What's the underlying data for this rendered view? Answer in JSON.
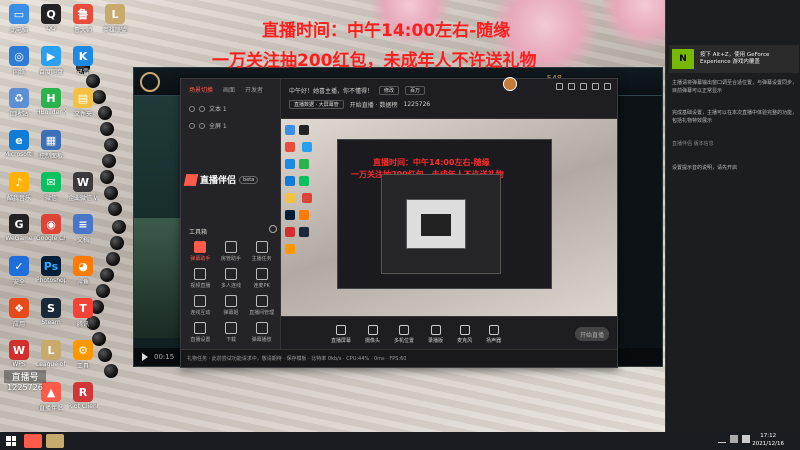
{
  "overlay": {
    "line1": "直播时间：中午14:00左右-随缘",
    "line2": "一万关注抽200红包，未成年人不许送礼物"
  },
  "desktop_icons": [
    {
      "label": "此电脑",
      "icon": "computer-icon",
      "color": "#3a8ee6"
    },
    {
      "label": "QQ",
      "icon": "qq-icon",
      "color": "#222"
    },
    {
      "label": "鲁大师",
      "icon": "ludashi-icon",
      "color": "#e84c3d"
    },
    {
      "label": "英雄联盟",
      "icon": "lol-icon",
      "color": "#c8aa6e"
    },
    {
      "label": "网络",
      "icon": "network-icon",
      "color": "#2d7bd6"
    },
    {
      "label": "百度网盘",
      "icon": "baidu-netdisk-icon",
      "color": "#2aa1f0"
    },
    {
      "label": "迅雷",
      "icon": "xunlei-icon",
      "color": "#1e88e5"
    },
    {
      "label": "回收站",
      "icon": "recycle-bin-icon",
      "color": "#5d8fd4"
    },
    {
      "label": "HBuilder X",
      "icon": "hbuilder-icon",
      "color": "#2bb24c"
    },
    {
      "label": "文件夹",
      "icon": "folder-icon",
      "color": "#f4c142"
    },
    {
      "label": "Microsoft Edge",
      "icon": "edge-icon",
      "color": "#0f7cd8"
    },
    {
      "label": "控制面板",
      "icon": "control-panel-icon",
      "color": "#3c6fb6"
    },
    {
      "label": "酷我音乐",
      "icon": "music-icon",
      "color": "#ffb300"
    },
    {
      "label": "微信",
      "icon": "wechat-icon",
      "color": "#07c160"
    },
    {
      "label": "企业微信 WeGame",
      "icon": "wegame-icon",
      "color": "#3b3b3b"
    },
    {
      "label": "WeGame",
      "icon": "wegame2-icon",
      "color": "#222"
    },
    {
      "label": "Google Chrome",
      "icon": "chrome-icon",
      "color": "#db4437"
    },
    {
      "label": "文档",
      "icon": "doc-icon",
      "color": "#4a76c9"
    },
    {
      "label": "安全",
      "icon": "security-icon",
      "color": "#1e6fd9"
    },
    {
      "label": "Photoshop",
      "icon": "photoshop-icon",
      "color": "#001e36"
    },
    {
      "label": "斗鱼",
      "icon": "douyu-icon",
      "color": "#ff7a00"
    },
    {
      "label": "应用",
      "icon": "app-icon",
      "color": "#e64a19"
    },
    {
      "label": "Steam",
      "icon": "steam-icon",
      "color": "#1b2838"
    },
    {
      "label": "腾讯",
      "icon": "tencent-icon",
      "color": "#f44336"
    },
    {
      "label": "WPS",
      "icon": "wps-icon",
      "color": "#d32f2f"
    },
    {
      "label": "League of Legends",
      "icon": "lol2-icon",
      "color": "#c8aa6e"
    },
    {
      "label": "工具",
      "icon": "tool-icon",
      "color": "#ff9800"
    },
    {
      "label": "直播伴侣",
      "icon": "live-companion-icon",
      "color": "#ff5a4a"
    },
    {
      "label": "Riot Client",
      "icon": "riot-icon",
      "color": "#d13639"
    }
  ],
  "game_window": {
    "coin": "548",
    "play_time": "00:15"
  },
  "app": {
    "tabs": [
      "场景切换",
      "画面",
      "开发者"
    ],
    "scenes": [
      "文本 1",
      "全屏 1"
    ],
    "logo": "直播伴侣",
    "version": "beta",
    "header_greeting": "中午好！她喜主播，你不懂得！",
    "header_btn1": "修改",
    "header_btn2": "百万",
    "header_row2": "直播数据 · 大屏幕管",
    "header_row2b": "开始直播 · 数据榜",
    "viewer_count": "1225726",
    "tools_title": "工具箱",
    "tools": [
      "弹幕助手",
      "房管助手",
      "主播任务",
      "视频直播",
      "多人连线",
      "连麦PK",
      "连线互动",
      "弹幕姬",
      "直播间管理",
      "直播设置",
      "下载",
      "弹幕播放"
    ],
    "toolbar": [
      "直播屏幕",
      "摄像头",
      "多机位置",
      "录播版",
      "麦克风",
      "扬声器"
    ],
    "start_live": "开始直播",
    "status": "礼物任务 · 此前尝试功能请求中，敬请期待 · 保存模板 · 比特率  0kb/s · CPU:44% · 0ms · FPS:60"
  },
  "nested": {
    "line1": "直播时间：中午14:00左右-随缘",
    "line2": "一万关注抽200红包，未成年人不许送礼物"
  },
  "notifications": {
    "toast_line1": "按下 Alt+Z，使用 GeForce",
    "toast_line2": "Experience 游戏内覆盖",
    "msg1": "主播请将弹幕输出窗口调至合适位置，与弹幕设置同步，目前弹幕可以正常显示",
    "msg2": "完成基础设置，主播可以在本次直播中体验完整的功能，包括礼物特效展示",
    "msg3": "设置提示音的说明，请先开启",
    "version": "直播伴侣 版本信息"
  },
  "user_badge": {
    "line1": "直播号",
    "line2": "1225726"
  },
  "taskbar": {
    "time": "17:12",
    "date": "2021/12/16"
  }
}
